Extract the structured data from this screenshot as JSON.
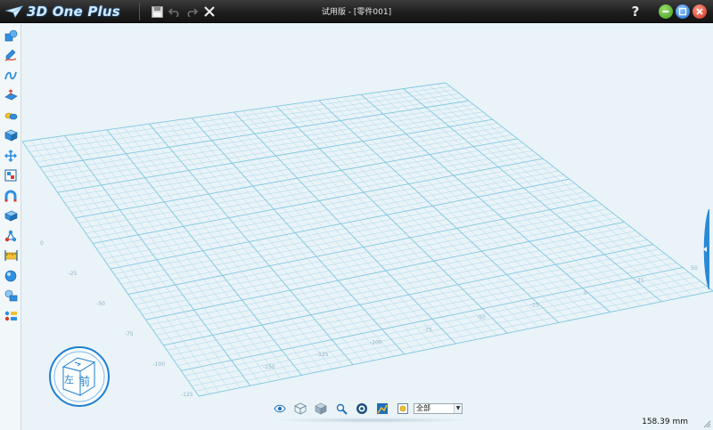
{
  "app": {
    "logo_text": "3D One Plus",
    "window_title": "试用版 - [零件001]"
  },
  "quick_access": [
    {
      "name": "save-icon"
    },
    {
      "name": "undo-icon"
    },
    {
      "name": "redo-icon"
    },
    {
      "name": "close-icon"
    }
  ],
  "window_controls": [
    {
      "name": "help-icon",
      "label": "?"
    },
    {
      "name": "minimize-icon",
      "color": "#4caf2f"
    },
    {
      "name": "restore-icon",
      "color": "#1f7fe0"
    },
    {
      "name": "window-close-icon",
      "color": "#d23b2b"
    }
  ],
  "left_toolbar": [
    "basic-solid-icon",
    "sketch-icon",
    "curve-icon",
    "special-function-icon",
    "combine-icon",
    "feature-icon",
    "move-icon",
    "array-icon",
    "magnet-icon",
    "pattern-icon",
    "assembly-icon",
    "distance-icon",
    "material-icon",
    "view-icon",
    "library-icon"
  ],
  "grid": {
    "axis_labels_left": [
      "0",
      "-25",
      "-50",
      "-75",
      "-100",
      "-125"
    ],
    "axis_labels_bottom": [
      "-150",
      "-125",
      "-100",
      "-75",
      "-50",
      "-25",
      "0",
      "25",
      "50"
    ]
  },
  "view_cube": {
    "face_front": "前",
    "face_left": "左"
  },
  "bottom_bar": {
    "icons": [
      "eye-icon",
      "wireframe-cube-icon",
      "shaded-cube-icon",
      "zoom-icon",
      "fit-view-icon",
      "render-mode-icon",
      "filter-icon"
    ],
    "filter_value": "全部"
  },
  "status": {
    "measurement": "158.39 mm"
  },
  "colors": {
    "grid_minor": "#a9d8ea",
    "grid_major": "#7fc7e0",
    "accent": "#2a8ad8"
  }
}
